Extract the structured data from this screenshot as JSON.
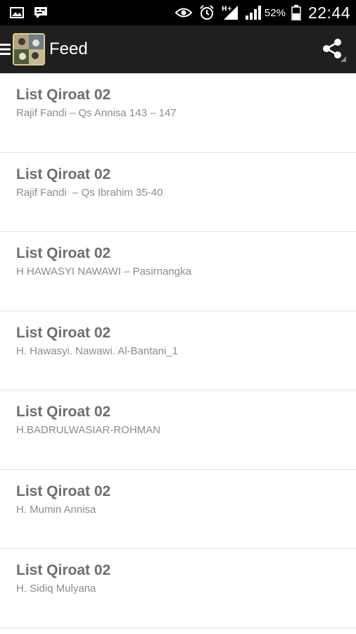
{
  "status_bar": {
    "battery_percent": "52%",
    "time": "22:44",
    "network_type": "H+",
    "icons": [
      "image-icon",
      "chat-icon",
      "eye-icon",
      "alarm-icon",
      "signal-icon",
      "battery-icon"
    ]
  },
  "action_bar": {
    "title": "Feed",
    "icons": [
      "hamburger-menu-icon",
      "app-logo",
      "share-icon"
    ]
  },
  "feed": {
    "items": [
      {
        "title": "List Qiroat 02",
        "subtitle": "Rajif Fandi – Qs Annisa 143 – 147"
      },
      {
        "title": "List Qiroat 02",
        "subtitle": "Rajif Fandi  – Qs Ibrahim 35-40"
      },
      {
        "title": "List Qiroat 02",
        "subtitle": "H HAWASYI NAWAWI – Pasirnangka"
      },
      {
        "title": "List Qiroat 02",
        "subtitle": "H. Hawasyi. Nawawi. Al-Bantani_1"
      },
      {
        "title": "List Qiroat 02",
        "subtitle": "H.BADRULWASIAR-ROHMAN"
      },
      {
        "title": "List Qiroat 02",
        "subtitle": "H. Mumin Annisa"
      },
      {
        "title": "List Qiroat 02",
        "subtitle": "H. Sidiq Mulyana"
      }
    ]
  },
  "colors": {
    "status_bar": "#000000",
    "action_bar": "#1f1f1f",
    "title_text": "#6e6e6e",
    "subtitle_text": "#8c8c8c",
    "divider": "#e3e3e3"
  }
}
